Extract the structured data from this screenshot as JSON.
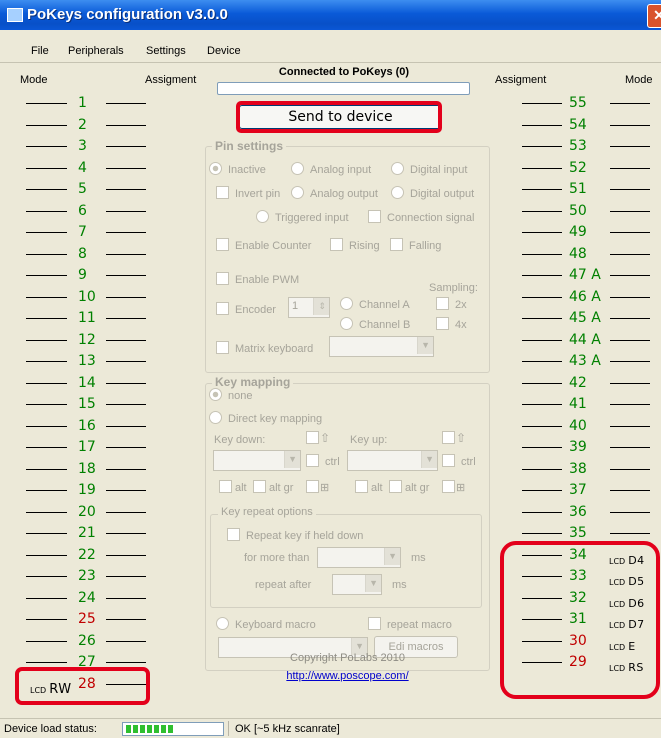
{
  "window": {
    "title": "PoKeys configuration v3.0.0",
    "close_icon": "close-icon"
  },
  "menu": {
    "file": "File",
    "peripherals": "Peripherals",
    "settings": "Settings",
    "device": "Device"
  },
  "header": {
    "left_mode": "Mode",
    "left_assignment": "Assigment",
    "right_assignment": "Assigment",
    "right_mode": "Mode"
  },
  "connection": {
    "status": "Connected to PoKeys (0)"
  },
  "send_button": "Send to device",
  "left_pins": [
    {
      "label": "1",
      "color": "green"
    },
    {
      "label": "2",
      "color": "green"
    },
    {
      "label": "3",
      "color": "green"
    },
    {
      "label": "4",
      "color": "green"
    },
    {
      "label": "5",
      "color": "green"
    },
    {
      "label": "6",
      "color": "green"
    },
    {
      "label": "7",
      "color": "green"
    },
    {
      "label": "8",
      "color": "green"
    },
    {
      "label": "9",
      "color": "green"
    },
    {
      "label": "10",
      "color": "green"
    },
    {
      "label": "11",
      "color": "green"
    },
    {
      "label": "12",
      "color": "green"
    },
    {
      "label": "13",
      "color": "green"
    },
    {
      "label": "14",
      "color": "green"
    },
    {
      "label": "15",
      "color": "green"
    },
    {
      "label": "16",
      "color": "green"
    },
    {
      "label": "17",
      "color": "green"
    },
    {
      "label": "18",
      "color": "green"
    },
    {
      "label": "19",
      "color": "green"
    },
    {
      "label": "20",
      "color": "green"
    },
    {
      "label": "21",
      "color": "green"
    },
    {
      "label": "22",
      "color": "green"
    },
    {
      "label": "23",
      "color": "green"
    },
    {
      "label": "24",
      "color": "green"
    },
    {
      "label": "25",
      "color": "red"
    },
    {
      "label": "26",
      "color": "green"
    },
    {
      "label": "27",
      "color": "green"
    },
    {
      "label": "28",
      "color": "red"
    }
  ],
  "right_pins": [
    {
      "label": "55",
      "color": "green"
    },
    {
      "label": "54",
      "color": "green"
    },
    {
      "label": "53",
      "color": "green"
    },
    {
      "label": "52",
      "color": "green"
    },
    {
      "label": "51",
      "color": "green"
    },
    {
      "label": "50",
      "color": "green"
    },
    {
      "label": "49",
      "color": "green"
    },
    {
      "label": "48",
      "color": "green"
    },
    {
      "label": "47 A",
      "color": "green"
    },
    {
      "label": "46 A",
      "color": "green"
    },
    {
      "label": "45 A",
      "color": "green"
    },
    {
      "label": "44 A",
      "color": "green"
    },
    {
      "label": "43 A",
      "color": "green"
    },
    {
      "label": "42",
      "color": "green"
    },
    {
      "label": "41",
      "color": "green"
    },
    {
      "label": "40",
      "color": "green"
    },
    {
      "label": "39",
      "color": "green"
    },
    {
      "label": "38",
      "color": "green"
    },
    {
      "label": "37",
      "color": "green"
    },
    {
      "label": "36",
      "color": "green"
    },
    {
      "label": "35",
      "color": "green"
    },
    {
      "label": "34",
      "color": "green"
    },
    {
      "label": "33",
      "color": "green"
    },
    {
      "label": "32",
      "color": "green"
    },
    {
      "label": "31",
      "color": "green"
    },
    {
      "label": "30",
      "color": "red"
    },
    {
      "label": "29",
      "color": "red"
    }
  ],
  "lcd_labels": {
    "rw": {
      "prefix": "LCD",
      "name": "RW"
    },
    "d4": {
      "prefix": "LCD",
      "name": "D4"
    },
    "d5": {
      "prefix": "LCD",
      "name": "D5"
    },
    "d6": {
      "prefix": "LCD",
      "name": "D6"
    },
    "d7": {
      "prefix": "LCD",
      "name": "D7"
    },
    "e": {
      "prefix": "LCD",
      "name": "E"
    },
    "rs": {
      "prefix": "LCD",
      "name": "RS"
    }
  },
  "pin_settings": {
    "title": "Pin settings",
    "inactive": "Inactive",
    "analog_input": "Analog input",
    "digital_input": "Digital input",
    "invert_pin": "Invert pin",
    "analog_output": "Analog output",
    "digital_output": "Digital output",
    "triggered_input": "Triggered input",
    "connection_signal": "Connection signal",
    "enable_counter": "Enable Counter",
    "rising": "Rising",
    "falling": "Falling",
    "enable_pwm": "Enable PWM",
    "sampling": "Sampling:",
    "encoder": "Encoder",
    "encoder_value": "1",
    "channel_a": "Channel A",
    "channel_b": "Channel B",
    "sampling_2x": "2x",
    "sampling_4x": "4x",
    "matrix_keyboard": "Matrix keyboard"
  },
  "key_mapping": {
    "title": "Key mapping",
    "none": "none",
    "direct": "Direct key mapping",
    "key_down": "Key down:",
    "key_up": "Key up:",
    "ctrl": "ctrl",
    "alt": "alt",
    "alt_gr": "alt gr",
    "repeat_title": "Key repeat options",
    "repeat_if_held": "Repeat key if held down",
    "for_more_than": "for more than",
    "repeat_after": "repeat after",
    "ms": "ms",
    "keyboard_macro": "Keyboard macro",
    "repeat_macro": "repeat macro",
    "edit_macros": "Edi macros"
  },
  "footer": {
    "copyright": "Copyright PoLabs 2010",
    "url": "http://www.poscope.com/"
  },
  "status": {
    "label": "Device load status:",
    "progress_segments": 7,
    "text": "OK [~5 kHz scanrate]"
  },
  "colors": {
    "green": "#008000",
    "red": "#c00000",
    "highlight": "#e3001b"
  }
}
